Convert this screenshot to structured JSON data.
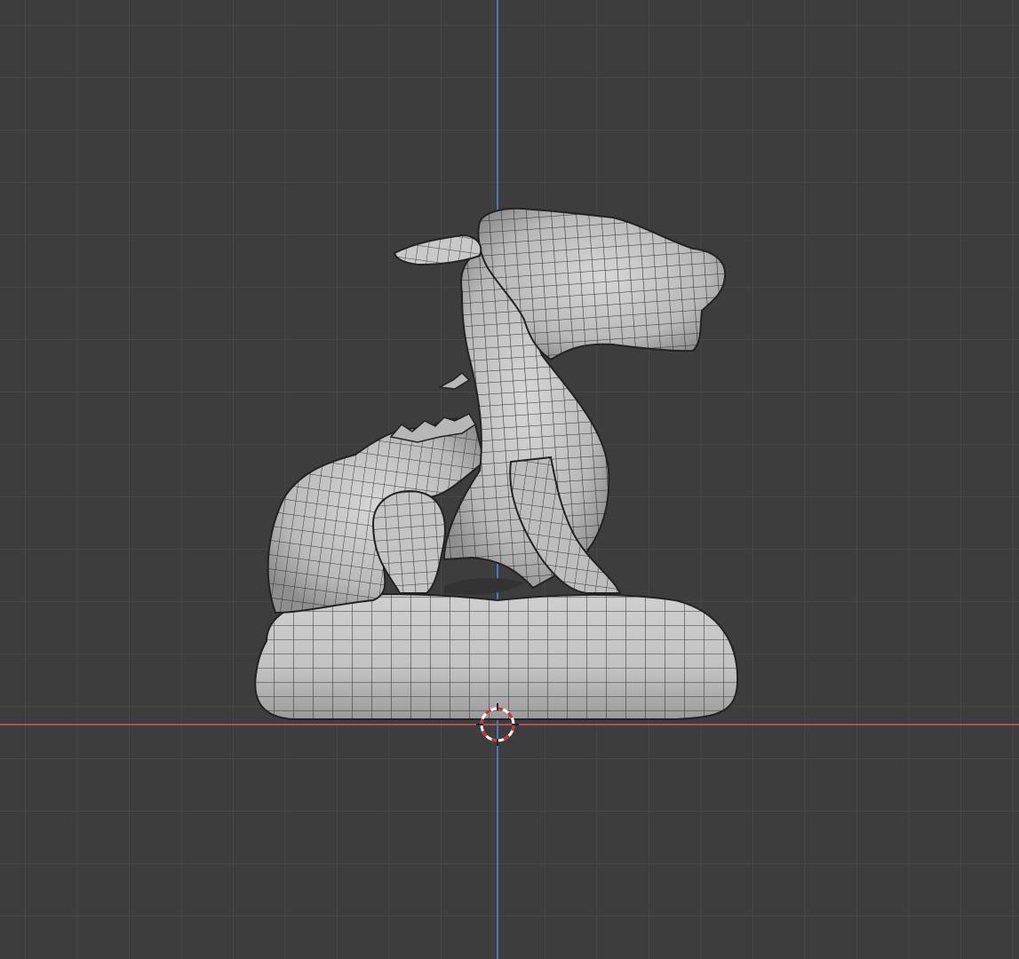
{
  "viewport": {
    "view": "front-orthographic",
    "shading": "solid-with-wireframe",
    "background_color": "#3d3d3d",
    "grid_color": "#4a4a4a",
    "x_axis_color": "#b24f5d",
    "z_axis_color": "#4a7ab5",
    "mesh_color": "#c8c8c8",
    "wire_color": "#1e1e1e"
  },
  "scene": {
    "object": "dragon-on-base-mesh",
    "origin_marker": "3d-cursor-icon"
  }
}
